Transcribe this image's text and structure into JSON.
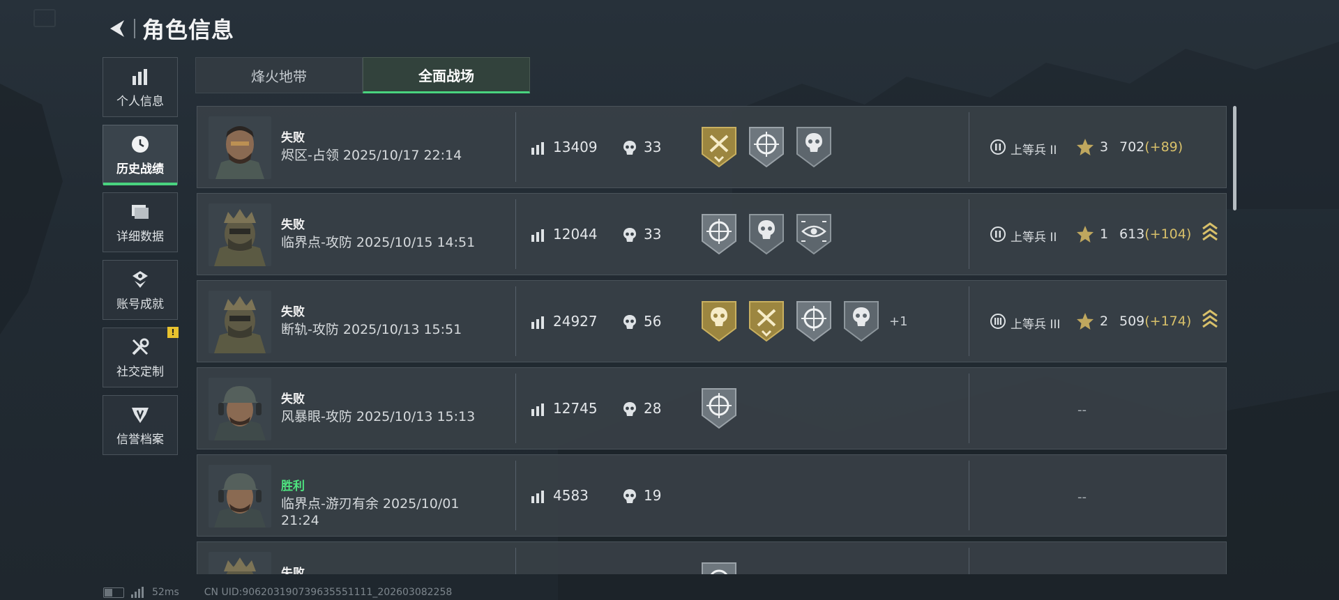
{
  "header": {
    "title": "角色信息"
  },
  "sidebar": {
    "items": [
      {
        "label": "个人信息",
        "icon": "bar-chart-icon",
        "active": false
      },
      {
        "label": "历史战绩",
        "icon": "clock-icon",
        "active": true
      },
      {
        "label": "详细数据",
        "icon": "folder-icon",
        "active": false
      },
      {
        "label": "账号成就",
        "icon": "achievement-icon",
        "active": false
      },
      {
        "label": "社交定制",
        "icon": "tools-icon",
        "active": false,
        "badge": "!"
      },
      {
        "label": "信誉档案",
        "icon": "shield-icon",
        "active": false
      }
    ]
  },
  "tabs": [
    {
      "label": "烽火地带",
      "active": false
    },
    {
      "label": "全面战场",
      "active": true
    }
  ],
  "matches": [
    {
      "result": "失败",
      "map": "烬区-占领 2025/10/17 22:14",
      "score": "13409",
      "kills": "33",
      "medals": [
        "gold-axe",
        "silver-target",
        "silver-skull"
      ],
      "rank": "上等兵 II",
      "stars": "3",
      "points": "702",
      "delta": "(+89)",
      "rank_up": false
    },
    {
      "result": "失败",
      "map": "临界点-攻防 2025/10/15 14:51",
      "score": "12044",
      "kills": "33",
      "medals": [
        "silver-target",
        "silver-skull",
        "silver-eye"
      ],
      "rank": "上等兵 II",
      "stars": "1",
      "points": "613",
      "delta": "(+104)",
      "rank_up": true
    },
    {
      "result": "失败",
      "map": "断轨-攻防 2025/10/13 15:51",
      "score": "24927",
      "kills": "56",
      "medals": [
        "gold-skull",
        "gold-axe",
        "silver-target",
        "silver-skull"
      ],
      "more": "+1",
      "rank": "上等兵 III",
      "stars": "2",
      "points": "509",
      "delta": "(+174)",
      "rank_up": true
    },
    {
      "result": "失败",
      "map": "风暴眼-攻防 2025/10/13 15:13",
      "score": "12745",
      "kills": "28",
      "medals": [
        "silver-target"
      ],
      "dash": "--"
    },
    {
      "result": "胜利",
      "map": "临界点-游刃有余 2025/10/01 21:24",
      "score": "4583",
      "kills": "19",
      "medals": [],
      "dash": "--"
    },
    {
      "result": "失败",
      "map": "",
      "score": "",
      "kills": "",
      "medals": [
        "silver-target"
      ],
      "dash": ""
    }
  ],
  "footer": {
    "ping": "52ms",
    "uid": "CN UID:906203190739635551111_202603082258"
  },
  "colors": {
    "accent": "#49d37f",
    "win": "#4ee37f",
    "delta": "#d8c06a",
    "badge": "#e8c22e"
  }
}
